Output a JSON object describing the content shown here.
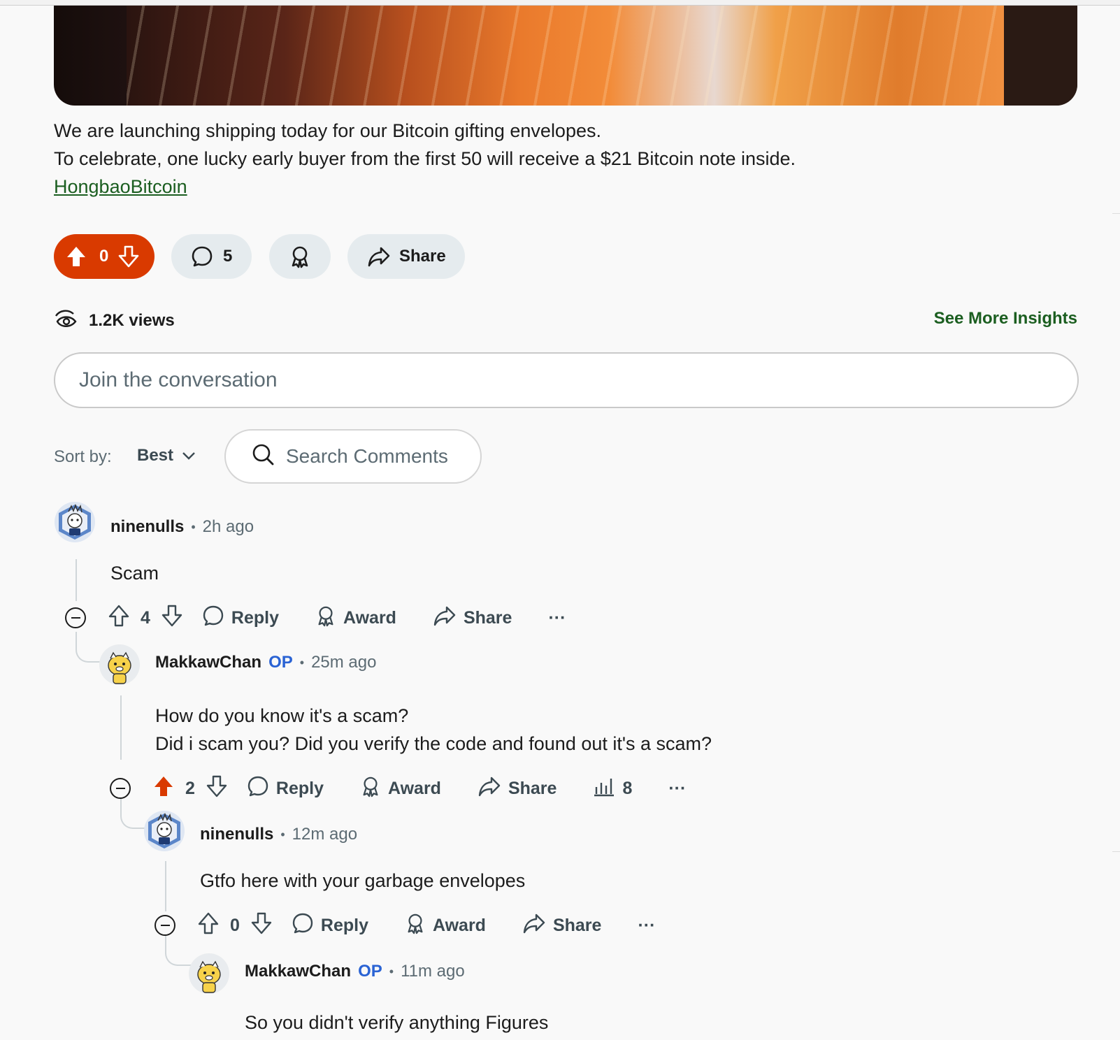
{
  "post": {
    "text_line1": "We are launching shipping today for our Bitcoin gifting envelopes.",
    "text_line2": "To celebrate, one lucky early buyer from the first 50 will receive a $21 Bitcoin note inside.",
    "link_text": "HongbaoBitcoin",
    "vote_count": "0",
    "comment_count": "5",
    "share_label": "Share",
    "views": "1.2K views",
    "insights_label": "See More Insights"
  },
  "composer": {
    "placeholder": "Join the conversation"
  },
  "sort": {
    "label": "Sort by:",
    "value": "Best",
    "search_placeholder": "Search Comments"
  },
  "colors": {
    "upvote_active": "#d93a00",
    "link": "#1b5e20",
    "op": "#2a63d4",
    "pill_bg": "#e5ebee"
  },
  "comments": [
    {
      "user": "ninenulls",
      "op": "",
      "time": "2h ago",
      "lines": [
        "Scam"
      ],
      "votes": "4",
      "upvoted": false,
      "reply": "Reply",
      "award": "Award",
      "share": "Share",
      "more": "···"
    },
    {
      "user": "MakkawChan",
      "op": "OP",
      "time": "25m ago",
      "lines": [
        "How do you know it's a scam?",
        "Did i scam you? Did you verify the code and found out it's a scam?"
      ],
      "votes": "2",
      "upvoted": true,
      "reply": "Reply",
      "award": "Award",
      "share": "Share",
      "insights": "8",
      "more": "···"
    },
    {
      "user": "ninenulls",
      "op": "",
      "time": "12m ago",
      "lines": [
        "Gtfo here with your garbage envelopes"
      ],
      "votes": "0",
      "upvoted": false,
      "reply": "Reply",
      "award": "Award",
      "share": "Share",
      "more": "···"
    },
    {
      "user": "MakkawChan",
      "op": "OP",
      "time": "11m ago",
      "lines": [
        "So you didn't verify anything Figures"
      ]
    }
  ]
}
